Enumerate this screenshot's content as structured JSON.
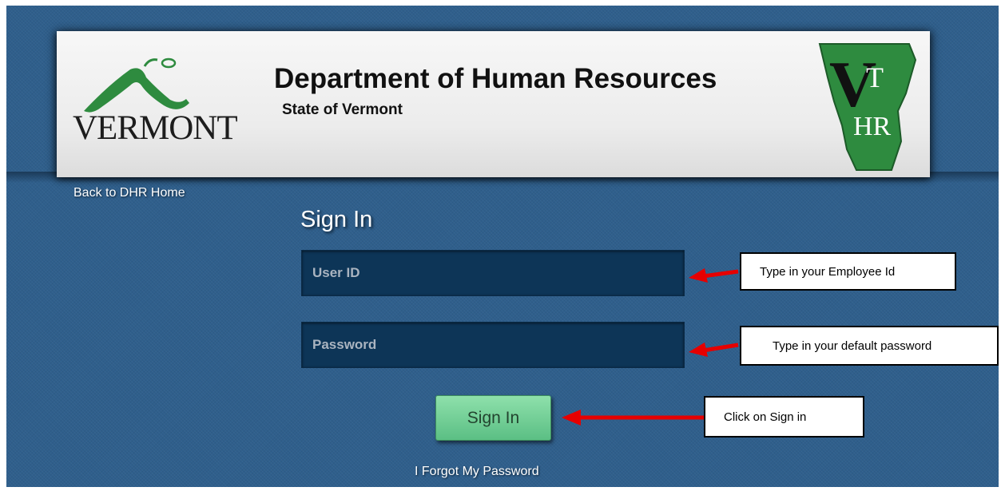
{
  "header": {
    "logo_text": "VERMONT",
    "title": "Department of Human Resources",
    "subtitle": "State of Vermont",
    "badge_text": [
      "VT",
      "HR"
    ]
  },
  "nav": {
    "back_link": "Back to DHR Home"
  },
  "signin": {
    "heading": "Sign In",
    "userid_placeholder": "User ID",
    "password_placeholder": "Password",
    "button_label": "Sign In",
    "forgot_link": "I Forgot My Password"
  },
  "annotations": {
    "userid_note": "Type in your Employee Id",
    "password_note": "Type in your default password",
    "signin_note": "Click on Sign in"
  },
  "colors": {
    "background": "#2f5f8c",
    "field": "#0d3557",
    "button": "#6fcf92",
    "arrow": "#e60000",
    "logo_green": "#2e8b3f"
  }
}
